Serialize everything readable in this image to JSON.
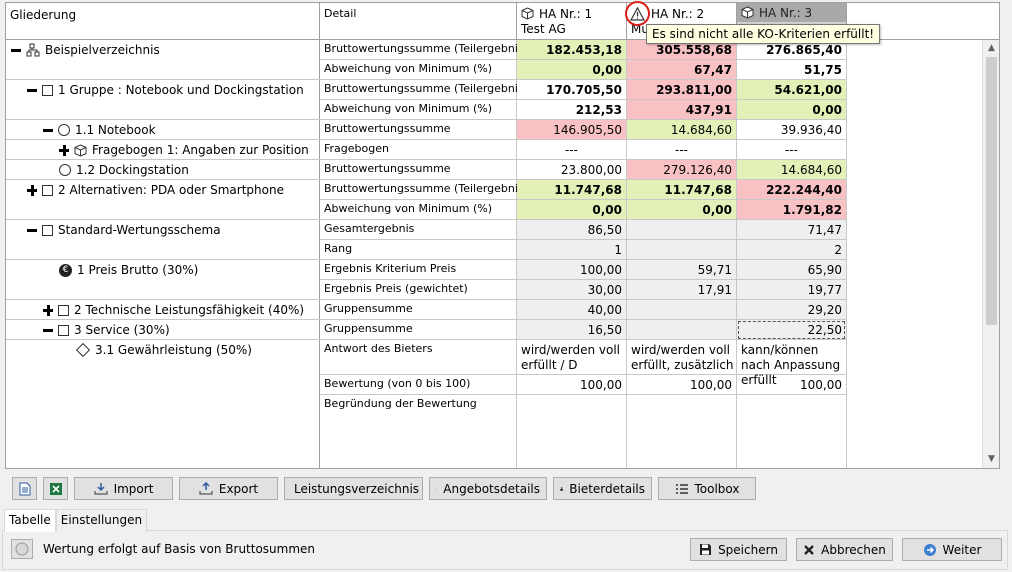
{
  "header": {
    "tree_label": "Gliederung",
    "detail_label": "Detail",
    "bidders": [
      {
        "nr": "HA Nr.: 1",
        "name": "Test AG"
      },
      {
        "nr": "HA Nr.: 2",
        "name": "Mu"
      },
      {
        "nr": "HA Nr.: 3",
        "name": ""
      }
    ]
  },
  "tooltip": "Es sind nicht alle KO-Kriterien erfüllt!",
  "tree": [
    "Beispielverzeichnis",
    "1 Gruppe : Notebook und Dockingstation",
    "1.1 Notebook",
    "Fragebogen 1: Angaben zur Position",
    "1.2 Dockingstation",
    "2 Alternativen: PDA oder Smartphone",
    "Standard-Wertungsschema",
    "1 Preis Brutto (30%)",
    "2 Technische Leistungsfähigkeit (40%)",
    "3 Service (30%)",
    "3.1 Gewährleistung (50%)"
  ],
  "details": [
    "Bruttowertungssumme (Teilergebnis)",
    "Abweichung von Minimum (%)",
    "Bruttowertungssumme (Teilergebnis)",
    "Abweichung von Minimum (%)",
    "Bruttowertungssumme",
    "Fragebogen",
    "Bruttowertungssumme",
    "Bruttowertungssumme (Teilergebnis)",
    "Abweichung von Minimum (%)",
    "Gesamtergebnis",
    "Rang",
    "Ergebnis Kriterium Preis",
    "Ergebnis Preis (gewichtet)",
    "Gruppensumme",
    "Gruppensumme",
    "Antwort des Bieters",
    "Bewertung (von 0 bis 100)",
    "Begründung der Bewertung"
  ],
  "values": [
    [
      "182.453,18",
      "305.558,68",
      "276.865,40"
    ],
    [
      "0,00",
      "67,47",
      "51,75"
    ],
    [
      "170.705,50",
      "293.811,00",
      "54.621,00"
    ],
    [
      "212,53",
      "437,91",
      "0,00"
    ],
    [
      "146.905,50",
      "14.684,60",
      "39.936,40"
    ],
    [
      "---",
      "---",
      "---"
    ],
    [
      "23.800,00",
      "279.126,40",
      "14.684,60"
    ],
    [
      "11.747,68",
      "11.747,68",
      "222.244,40"
    ],
    [
      "0,00",
      "0,00",
      "1.791,82"
    ],
    [
      "86,50",
      "",
      "71,47"
    ],
    [
      "1",
      "",
      "2"
    ],
    [
      "100,00",
      "59,71",
      "65,90"
    ],
    [
      "30,00",
      "17,91",
      "19,77"
    ],
    [
      "40,00",
      "",
      "29,20"
    ],
    [
      "16,50",
      "",
      "22,50"
    ],
    [
      "wird/werden voll erfüllt / D",
      "wird/werden voll erfüllt, zusätzlich",
      "kann/können nach Anpassung erfüllt"
    ],
    [
      "100,00",
      "100,00",
      "100,00"
    ],
    [
      "",
      "",
      ""
    ]
  ],
  "toolbar": {
    "import": "Import",
    "export": "Export",
    "leistungsverzeichnis": "Leistungsverzeichnis",
    "angebotsdetails": "Angebotsdetails",
    "bieterdetails": "Bieterdetails",
    "toolbox": "Toolbox"
  },
  "tabs": [
    "Tabelle",
    "Einstellungen"
  ],
  "status_text": "Wertung erfolgt auf Basis von Bruttosummen",
  "buttons": {
    "save": "Speichern",
    "cancel": "Abbrechen",
    "next": "Weiter"
  }
}
